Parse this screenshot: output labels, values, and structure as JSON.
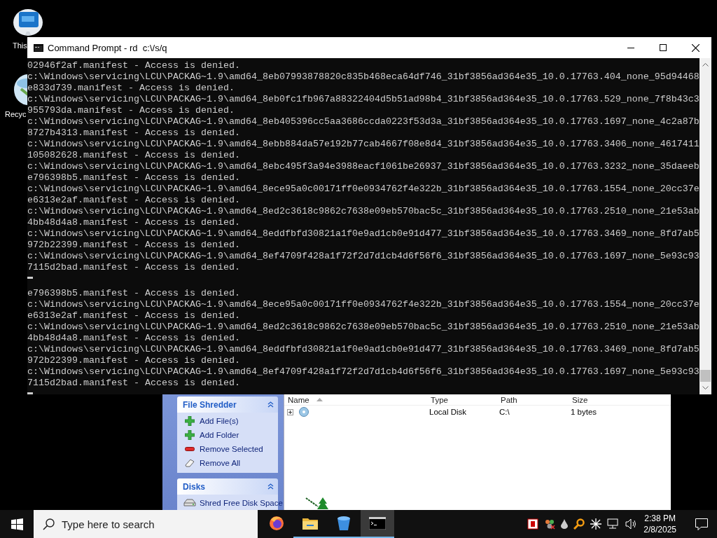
{
  "desktop_icons": [
    {
      "label": "This"
    },
    {
      "label": "Recyc"
    }
  ],
  "shredder": {
    "panels": [
      {
        "title": "File Shredder",
        "expanded": true,
        "items": [
          {
            "label": "Add File(s)",
            "kind": "add"
          },
          {
            "label": "Add Folder",
            "kind": "add"
          },
          {
            "label": "Remove Selected",
            "kind": "remove"
          },
          {
            "label": "Remove All",
            "kind": "eraser"
          }
        ]
      },
      {
        "title": "Disks",
        "expanded": true,
        "items": [
          {
            "label": "Shred Free Disk Space",
            "kind": "disk"
          }
        ]
      }
    ],
    "table": {
      "columns": [
        {
          "label": "Name",
          "sorted": true
        },
        {
          "label": "Type",
          "sorted": false
        },
        {
          "label": "Path",
          "sorted": false
        },
        {
          "label": "Size",
          "sorted": false
        }
      ],
      "rows": [
        {
          "expanded": false,
          "type": "Local Disk",
          "path": "C:\\",
          "size": "1 bytes"
        }
      ]
    }
  },
  "console": {
    "title": "Command Prompt - rd  c:\\/s/q",
    "lines": [
      {
        "kind": "text",
        "text": "02946f2af.manifest - Access is denied."
      },
      {
        "kind": "text",
        "text": "c:\\Windows\\servicing\\LCU\\PACKAG~1.9\\amd64_8eb07993878820c835b468eca64df746_31bf3856ad364e35_10.0.17763.404_none_95d94468"
      },
      {
        "kind": "text",
        "text": "e833d739.manifest - Access is denied."
      },
      {
        "kind": "text",
        "text": "c:\\Windows\\servicing\\LCU\\PACKAG~1.9\\amd64_8eb0fc1fb967a88322404d5b51ad98b4_31bf3856ad364e35_10.0.17763.529_none_7f8b43c3"
      },
      {
        "kind": "text",
        "text": "955793da.manifest - Access is denied."
      },
      {
        "kind": "text",
        "text": "c:\\Windows\\servicing\\LCU\\PACKAG~1.9\\amd64_8eb405396cc5aa3686ccda0223f53d3a_31bf3856ad364e35_10.0.17763.1697_none_4c2a87b"
      },
      {
        "kind": "text",
        "text": "8727b4313.manifest - Access is denied."
      },
      {
        "kind": "text",
        "text": "c:\\Windows\\servicing\\LCU\\PACKAG~1.9\\amd64_8ebb884da57e192b77cab4667f08e8d4_31bf3856ad364e35_10.0.17763.3406_none_4617411"
      },
      {
        "kind": "text",
        "text": "105082628.manifest - Access is denied."
      },
      {
        "kind": "text",
        "text": "c:\\Windows\\servicing\\LCU\\PACKAG~1.9\\amd64_8ebc495f3a94e3988eacf1061be26937_31bf3856ad364e35_10.0.17763.3232_none_35daeeb"
      },
      {
        "kind": "text",
        "text": "e796398b5.manifest - Access is denied."
      },
      {
        "kind": "text",
        "text": "c:\\Windows\\servicing\\LCU\\PACKAG~1.9\\amd64_8ece95a0c00171ff0e0934762f4e322b_31bf3856ad364e35_10.0.17763.1554_none_20cc37e"
      },
      {
        "kind": "text",
        "text": "e6313e2af.manifest - Access is denied."
      },
      {
        "kind": "text",
        "text": "c:\\Windows\\servicing\\LCU\\PACKAG~1.9\\amd64_8ed2c3618c9862c7638e09eb570bac5c_31bf3856ad364e35_10.0.17763.2510_none_21e53ab"
      },
      {
        "kind": "text",
        "text": "4bb48d4a8.manifest - Access is denied."
      },
      {
        "kind": "text",
        "text": "c:\\Windows\\servicing\\LCU\\PACKAG~1.9\\amd64_8eddfbfd30821a1f0e9ad1cb0e91d477_31bf3856ad364e35_10.0.17763.3469_none_8fd7ab5"
      },
      {
        "kind": "text",
        "text": "972b22399.manifest - Access is denied."
      },
      {
        "kind": "text",
        "text": "c:\\Windows\\servicing\\LCU\\PACKAG~1.9\\amd64_8ef4709f428a1f72f2d7d1cb4d6f56f6_31bf3856ad364e35_10.0.17763.1697_none_5e93c93"
      },
      {
        "kind": "text",
        "text": "7115d2bad.manifest - Access is denied."
      },
      {
        "kind": "cursor"
      },
      {
        "kind": "text",
        "text": "e796398b5.manifest - Access is denied."
      },
      {
        "kind": "text",
        "text": "c:\\Windows\\servicing\\LCU\\PACKAG~1.9\\amd64_8ece95a0c00171ff0e0934762f4e322b_31bf3856ad364e35_10.0.17763.1554_none_20cc37e"
      },
      {
        "kind": "text",
        "text": "e6313e2af.manifest - Access is denied."
      },
      {
        "kind": "text",
        "text": "c:\\Windows\\servicing\\LCU\\PACKAG~1.9\\amd64_8ed2c3618c9862c7638e09eb570bac5c_31bf3856ad364e35_10.0.17763.2510_none_21e53ab"
      },
      {
        "kind": "text",
        "text": "4bb48d4a8.manifest - Access is denied."
      },
      {
        "kind": "text",
        "text": "c:\\Windows\\servicing\\LCU\\PACKAG~1.9\\amd64_8eddfbfd30821a1f0e9ad1cb0e91d477_31bf3856ad364e35_10.0.17763.3469_none_8fd7ab5"
      },
      {
        "kind": "text",
        "text": "972b22399.manifest - Access is denied."
      },
      {
        "kind": "text",
        "text": "c:\\Windows\\servicing\\LCU\\PACKAG~1.9\\amd64_8ef4709f428a1f72f2d7d1cb4d6f56f6_31bf3856ad364e35_10.0.17763.1697_none_5e93c93"
      },
      {
        "kind": "text",
        "text": "7115d2bad.manifest - Access is denied."
      },
      {
        "kind": "cursor"
      }
    ]
  },
  "taskbar": {
    "search": {
      "placeholder": "Type here to search"
    },
    "apps": [
      {
        "kind": "browser",
        "running": false,
        "selected": false
      },
      {
        "kind": "folder",
        "running": true,
        "selected": false
      },
      {
        "kind": "bin",
        "running": true,
        "selected": false
      },
      {
        "kind": "terminal",
        "running": true,
        "selected": true
      }
    ],
    "time": "2:38 PM",
    "date": "2/8/2025"
  }
}
